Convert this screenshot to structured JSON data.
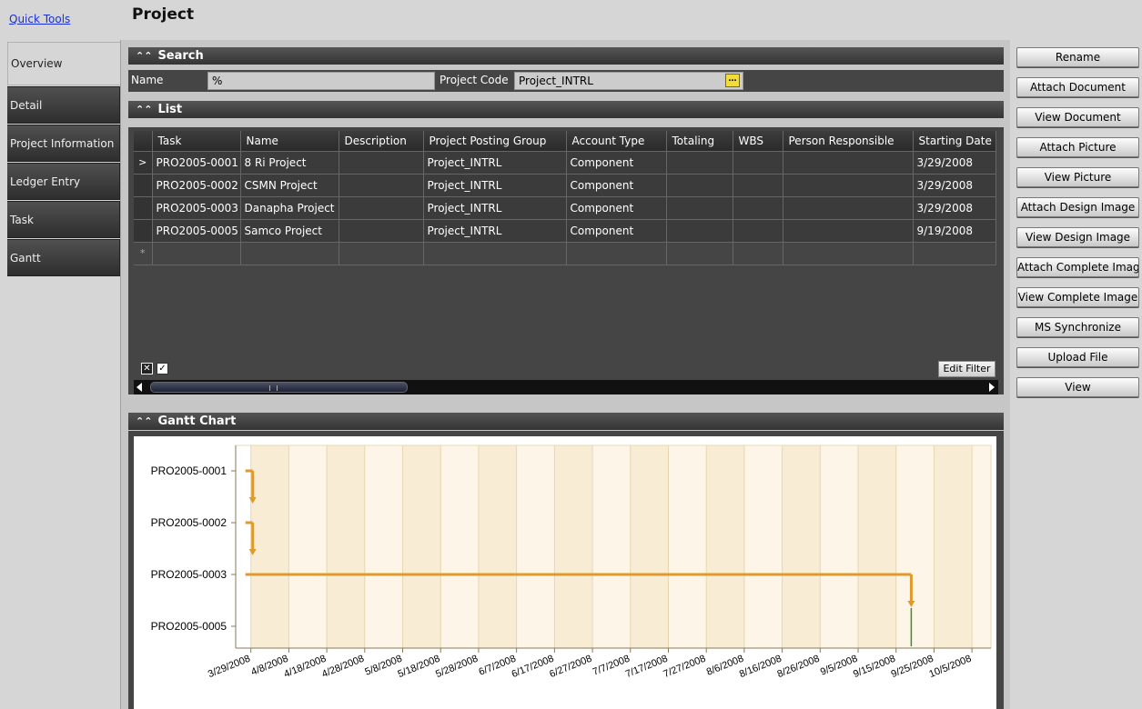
{
  "header": {
    "quick_tools": "Quick Tools",
    "title": "Project"
  },
  "nav": {
    "tabs": [
      {
        "label": "Overview",
        "active": true
      },
      {
        "label": "Detail"
      },
      {
        "label": "Project Information"
      },
      {
        "label": "Ledger Entry"
      },
      {
        "label": "Task"
      },
      {
        "label": "Gantt"
      }
    ]
  },
  "search": {
    "header": "Search",
    "name_label": "Name",
    "name_value": "%",
    "code_label": "Project Code",
    "code_value": "Project_INTRL",
    "lookup_icon": "ellipsis-icon"
  },
  "list": {
    "header": "List",
    "columns": [
      "Task",
      "Name",
      "Description",
      "Project Posting Group",
      "Account Type",
      "Totaling",
      "WBS",
      "Person Responsible",
      "Starting Date"
    ],
    "rows": [
      [
        "PRO2005-0001",
        "8 Ri Project",
        "",
        "Project_INTRL",
        "Component",
        "",
        "",
        "",
        "3/29/2008"
      ],
      [
        "PRO2005-0002",
        "CSMN Project",
        "",
        "Project_INTRL",
        "Component",
        "",
        "",
        "",
        "3/29/2008"
      ],
      [
        "PRO2005-0003",
        "Danapha Project",
        "",
        "Project_INTRL",
        "Component",
        "",
        "",
        "",
        "3/29/2008"
      ],
      [
        "PRO2005-0005",
        "Samco Project",
        "",
        "Project_INTRL",
        "Component",
        "",
        "",
        "",
        "9/19/2008"
      ]
    ],
    "current_row_marker": ">",
    "new_row_marker": "*",
    "edit_filter": "Edit Filter"
  },
  "gantt": {
    "header": "Gantt Chart",
    "bar_color": "#e09a2a",
    "milestone_color": "#3c8a2a"
  },
  "chart_data": {
    "type": "gantt",
    "categories": [
      "PRO2005-0001",
      "PRO2005-0002",
      "PRO2005-0003",
      "PRO2005-0005"
    ],
    "x_tick_labels": [
      "3/29/2008",
      "4/8/2008",
      "4/18/2008",
      "4/28/2008",
      "5/8/2008",
      "5/18/2008",
      "5/28/2008",
      "6/7/2008",
      "6/17/2008",
      "6/27/2008",
      "7/7/2008",
      "7/17/2008",
      "7/27/2008",
      "8/6/2008",
      "8/16/2008",
      "8/26/2008",
      "9/5/2008",
      "9/15/2008",
      "9/25/2008",
      "10/5/2008"
    ],
    "x_range": [
      "3/25/2008",
      "10/10/2008"
    ],
    "tasks": [
      {
        "task": "PRO2005-0001",
        "start": "3/29/2008",
        "end": "3/29/2008",
        "link_to": "PRO2005-0002"
      },
      {
        "task": "PRO2005-0002",
        "start": "3/29/2008",
        "end": "3/29/2008",
        "link_to": "PRO2005-0003"
      },
      {
        "task": "PRO2005-0003",
        "start": "3/29/2008",
        "end": "9/19/2008",
        "link_to": "PRO2005-0005"
      },
      {
        "task": "PRO2005-0005",
        "start": "9/19/2008",
        "end": "9/19/2008"
      }
    ]
  },
  "actions": {
    "buttons": [
      "Rename",
      "Attach Document",
      "View Document",
      "Attach Picture",
      "View Picture",
      "Attach Design Image",
      "View Design Image",
      "Attach Complete Image",
      "View Complete Image",
      "MS Synchronize",
      "Upload File",
      "View"
    ]
  }
}
